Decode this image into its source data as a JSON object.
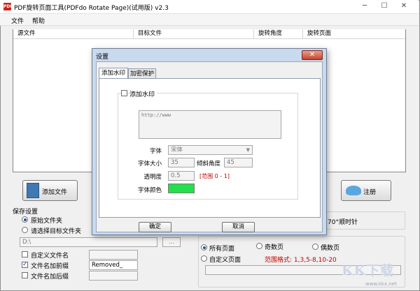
{
  "window": {
    "title": "PDF旋转页面工具(PDFdo Rotate Page)(试用版) v2.3",
    "icon_text": "PDF",
    "controls": {
      "minimize": "─",
      "maximize": "☐",
      "close": "✕"
    }
  },
  "menubar": {
    "items": [
      "文件",
      "帮助"
    ]
  },
  "file_list": {
    "columns": [
      "源文件",
      "目标文件",
      "旋转角度",
      "旋转页面"
    ],
    "rows": []
  },
  "buttons": {
    "add_file": "添加文件",
    "register": "注册"
  },
  "save_settings": {
    "title": "保存设置",
    "options": [
      "原始文件夹",
      "请选择目标文件夹"
    ],
    "selected": 0,
    "path_value": "D:\\",
    "browse_label": "...",
    "custom_filename_label": "自定义文件名",
    "prefix_label": "文件名加前缀",
    "prefix_value": "Removed_",
    "suffix_label": "文件名加后缀",
    "prefix_checked": true
  },
  "rotate_partial_text": "70°顺时针",
  "pages": {
    "options": [
      "所有页面",
      "奇数页",
      "偶数页",
      "自定义页面"
    ],
    "selected": 0,
    "range_hint": "范围格式: 1,3,5-8,10-20"
  },
  "dialog": {
    "title": "设置",
    "close_label": "✕",
    "tabs": [
      "添加水印",
      "加密保护"
    ],
    "active_tab": 0,
    "watermark_checkbox_label": "添加水印",
    "watermark_text": "http://www",
    "font_label": "字体",
    "font_value": "宋体",
    "font_size_label": "字体大小",
    "font_size_value": "35",
    "tilt_label": "倾斜角度",
    "tilt_value": "45",
    "opacity_label": "透明度",
    "opacity_value": "0.5",
    "opacity_range": "[范围 0 - 1]",
    "color_label": "字体颜色",
    "color_value": "#22e04d",
    "ok_label": "确定",
    "cancel_label": "取消"
  },
  "watermark_logo": {
    "text": "KK下载",
    "url": "www.kkx.net"
  },
  "colors": {
    "accent_red": "#d00000",
    "range_red": "#c00000",
    "swatch_green": "#22e04d"
  }
}
